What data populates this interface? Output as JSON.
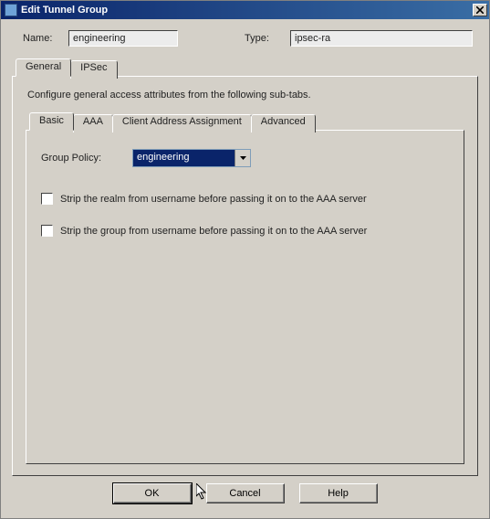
{
  "window": {
    "title": "Edit Tunnel Group"
  },
  "fields": {
    "name_label": "Name:",
    "name_value": "engineering",
    "type_label": "Type:",
    "type_value": "ipsec-ra"
  },
  "outerTabs": {
    "t0": "General",
    "t1": "IPSec"
  },
  "general": {
    "desc": "Configure general access attributes from the following sub-tabs.",
    "innerTabs": {
      "t0": "Basic",
      "t1": "AAA",
      "t2": "Client Address Assignment",
      "t3": "Advanced"
    },
    "basic": {
      "group_policy_label": "Group Policy:",
      "group_policy_value": "engineering",
      "strip_realm_label": "Strip the realm from username before passing it on to the AAA server",
      "strip_group_label": "Strip the group from username before passing it on to the AAA server"
    }
  },
  "buttons": {
    "ok": "OK",
    "cancel": "Cancel",
    "help": "Help"
  }
}
